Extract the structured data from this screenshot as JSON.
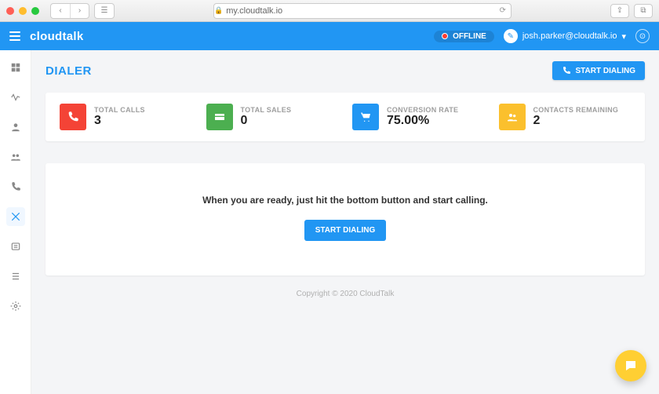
{
  "browser": {
    "url": "my.cloudtalk.io"
  },
  "header": {
    "brand": "cloudtalk",
    "status": "OFFLINE",
    "user_email": "josh.parker@cloudtalk.io"
  },
  "page": {
    "title": "DIALER",
    "start_button": "START DIALING"
  },
  "stats": {
    "total_calls": {
      "label": "TOTAL CALLS",
      "value": "3"
    },
    "total_sales": {
      "label": "TOTAL SALES",
      "value": "0"
    },
    "conversion_rate": {
      "label": "CONVERSION RATE",
      "value": "75.00%"
    },
    "contacts_remaining": {
      "label": "CONTACTS REMAINING",
      "value": "2"
    }
  },
  "empty_state": {
    "message": "When you are ready, just hit the bottom button and start calling.",
    "button": "START DIALING"
  },
  "footer": {
    "copyright": "Copyright © 2020 CloudTalk"
  },
  "sidebar": {
    "items": [
      "dashboard",
      "activity",
      "contact",
      "team",
      "calls",
      "dialer",
      "archive",
      "tasks",
      "settings"
    ],
    "active_index": 5
  }
}
